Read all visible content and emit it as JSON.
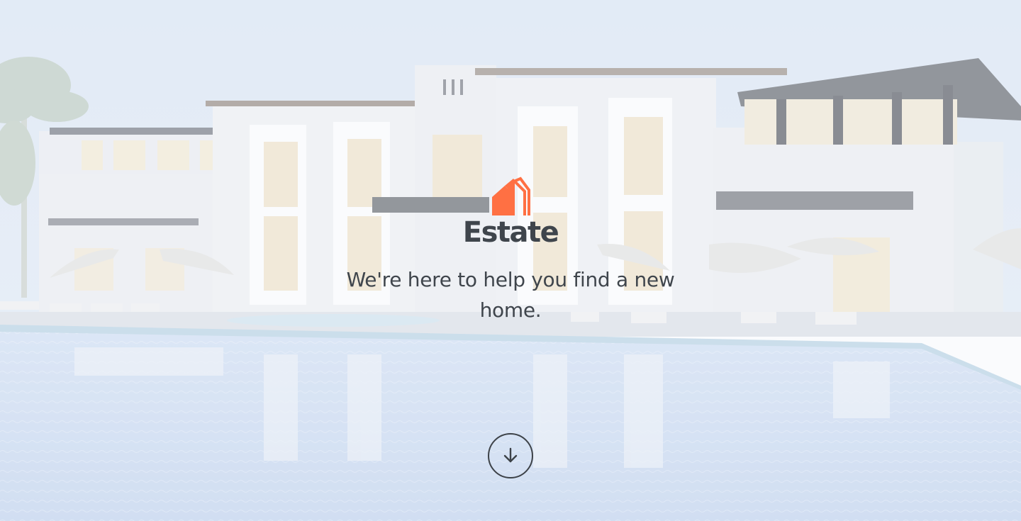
{
  "brand": {
    "name": "Estate",
    "logo_icon": "house-logo-icon"
  },
  "hero": {
    "tagline": "We're here to help you find a new home.",
    "scroll_icon": "arrow-down-icon"
  },
  "colors": {
    "accent": "#ff7043",
    "text_dark": "#3f454c",
    "sky": "#d8e6f4",
    "pool": "#c8daf2"
  }
}
